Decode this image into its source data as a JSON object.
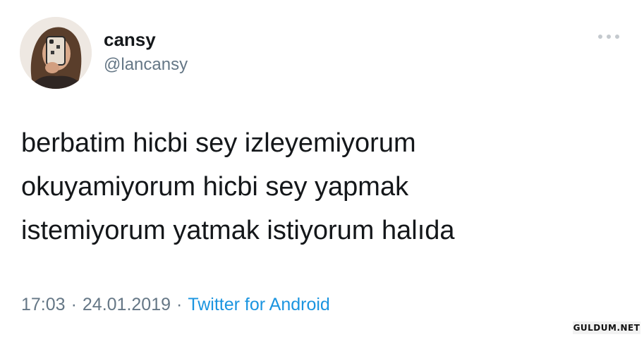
{
  "tweet": {
    "display_name": "cansy",
    "handle": "@lancansy",
    "text_lines": [
      "berbatim hicbi sey izleyemiyorum",
      "okuyamiyorum hicbi sey yapmak",
      "istemiyorum yatmak istiyorum halıda"
    ],
    "time": "17:03",
    "date": "24.01.2019",
    "separator": "·",
    "source": "Twitter for Android",
    "more_icon": "more-horizontal-icon"
  },
  "watermark": "GULDUM.NET",
  "colors": {
    "text": "#14171a",
    "secondary": "#657786",
    "link": "#1b95e0",
    "more_dots": "#c4c9ce"
  }
}
